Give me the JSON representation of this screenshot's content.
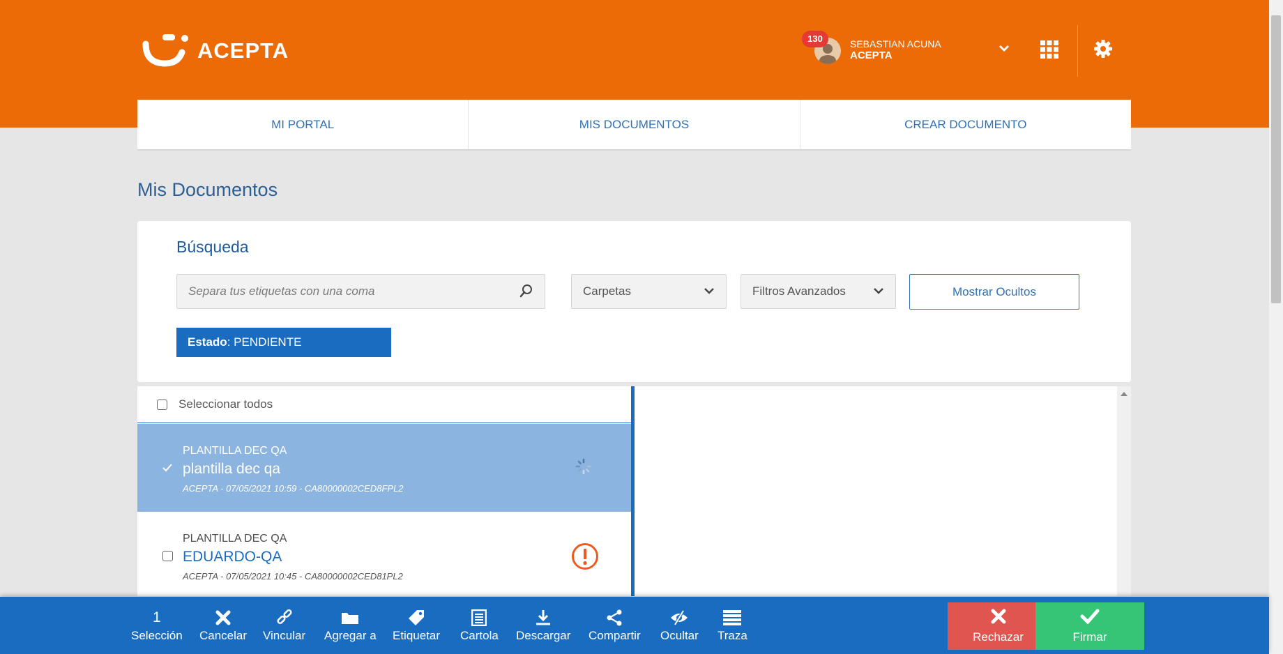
{
  "brand": {
    "name": "ACEPTA",
    "color": "#ed6b06",
    "accent": "#1a6cc1"
  },
  "header": {
    "notification_count": "130",
    "user_name": "SEBASTIAN ACUNA",
    "user_org": "ACEPTA",
    "icons": [
      "user-avatar",
      "chevron-down-icon",
      "apps-grid-icon",
      "gear-icon"
    ]
  },
  "nav": {
    "tabs": [
      {
        "label": "MI PORTAL"
      },
      {
        "label": "MIS DOCUMENTOS"
      },
      {
        "label": "CREAR DOCUMENTO"
      }
    ]
  },
  "page": {
    "title": "Mis Documentos"
  },
  "search": {
    "heading": "Búsqueda",
    "placeholder": "Separa tus etiquetas con una coma",
    "folders_label": "Carpetas",
    "filters_label": "Filtros Avanzados",
    "show_hidden_label": "Mostrar Ocultos",
    "status_key": "Estado",
    "status_value": ": PENDIENTE"
  },
  "list": {
    "select_all_label": "Seleccionar todos",
    "documents": [
      {
        "type": "PLANTILLA DEC QA",
        "name": "plantilla dec qa",
        "meta": "ACEPTA - 07/05/2021 10:59 - CA80000002CED8FPL2",
        "selected": true,
        "status_icon": "loading-spinner-icon"
      },
      {
        "type": "PLANTILLA DEC QA",
        "name": "EDUARDO-QA",
        "meta": "ACEPTA - 07/05/2021 10:45 - CA80000002CED81PL2",
        "selected": false,
        "status_icon": "warning-icon"
      }
    ]
  },
  "actions": {
    "selection_count": "1",
    "selection_label": "Selección",
    "cancel": "Cancelar",
    "link": "Vincular",
    "add_to": "Agregar a",
    "tag": "Etiquetar",
    "cartola": "Cartola",
    "download": "Descargar",
    "share": "Compartir",
    "hide": "Ocultar",
    "trace": "Traza",
    "reject": "Rechazar",
    "sign": "Firmar"
  }
}
